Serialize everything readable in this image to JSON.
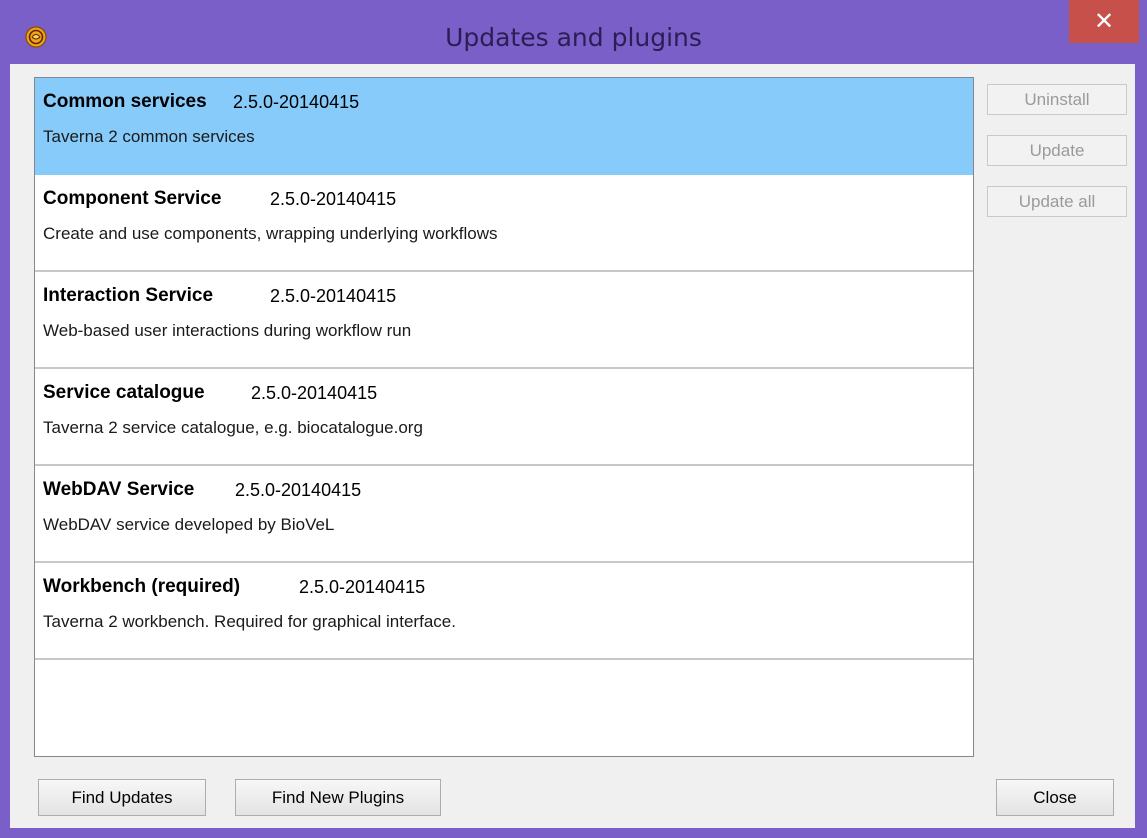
{
  "window": {
    "title": "Updates and plugins",
    "close_glyph": "✕",
    "accent_color": "#7b5fc9",
    "close_color": "#c7504a"
  },
  "plugins": [
    {
      "name": "Common services",
      "version": "2.5.0-20140415",
      "description": "Taverna 2 common services",
      "selected": true
    },
    {
      "name": "Component Service",
      "version": "2.5.0-20140415",
      "description": "Create and use components, wrapping underlying workflows",
      "selected": false
    },
    {
      "name": "Interaction Service",
      "version": "2.5.0-20140415",
      "description": "Web-based user interactions during workflow run",
      "selected": false
    },
    {
      "name": "Service catalogue",
      "version": "2.5.0-20140415",
      "description": "Taverna 2 service catalogue, e.g. biocatalogue.org",
      "selected": false
    },
    {
      "name": "WebDAV Service",
      "version": "2.5.0-20140415",
      "description": "WebDAV service developed by BioVeL",
      "selected": false
    },
    {
      "name": "Workbench (required)",
      "version": "2.5.0-20140415",
      "description": "Taverna 2 workbench. Required for graphical interface.",
      "selected": false
    }
  ],
  "side_buttons": {
    "uninstall": "Uninstall",
    "update": "Update",
    "update_all": "Update all"
  },
  "bottom_buttons": {
    "find_updates": "Find Updates",
    "find_new_plugins": "Find New Plugins",
    "close": "Close"
  },
  "selection_color": "#87cbfb"
}
